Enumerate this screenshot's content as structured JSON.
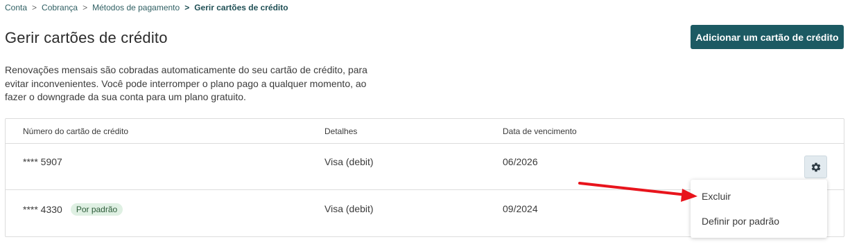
{
  "breadcrumb": {
    "items": [
      "Conta",
      "Cobrança",
      "Métodos de pagamento"
    ],
    "current": "Gerir cartões de crédito",
    "separator": ">"
  },
  "page": {
    "title": "Gerir cartões de crédito",
    "add_button": "Adicionar um cartão de crédito",
    "description": "Renovações mensais são cobradas automaticamente do seu cartão de crédito, para evitar inconvenientes. Você pode interromper o plano pago a qualquer momento, ao fazer o downgrade da sua conta para um plano gratuito."
  },
  "table": {
    "headers": [
      "Número do cartão de crédito",
      "Detalhes",
      "Data de vencimento"
    ],
    "rows": [
      {
        "number": "**** 5907",
        "details": "Visa (debit)",
        "expiry": "06/2026",
        "badge": ""
      },
      {
        "number": "**** 4330",
        "details": "Visa (debit)",
        "expiry": "09/2024",
        "badge": "Por padrão"
      }
    ]
  },
  "menu": {
    "items": [
      "Excluir",
      "Definir por padrão"
    ]
  },
  "icons": {
    "gear": "gear-icon",
    "arrow": "red-arrow-annotation"
  },
  "colors": {
    "primary": "#1c5a63",
    "badge_bg": "#dff0e3",
    "arrow": "#e8141c"
  }
}
